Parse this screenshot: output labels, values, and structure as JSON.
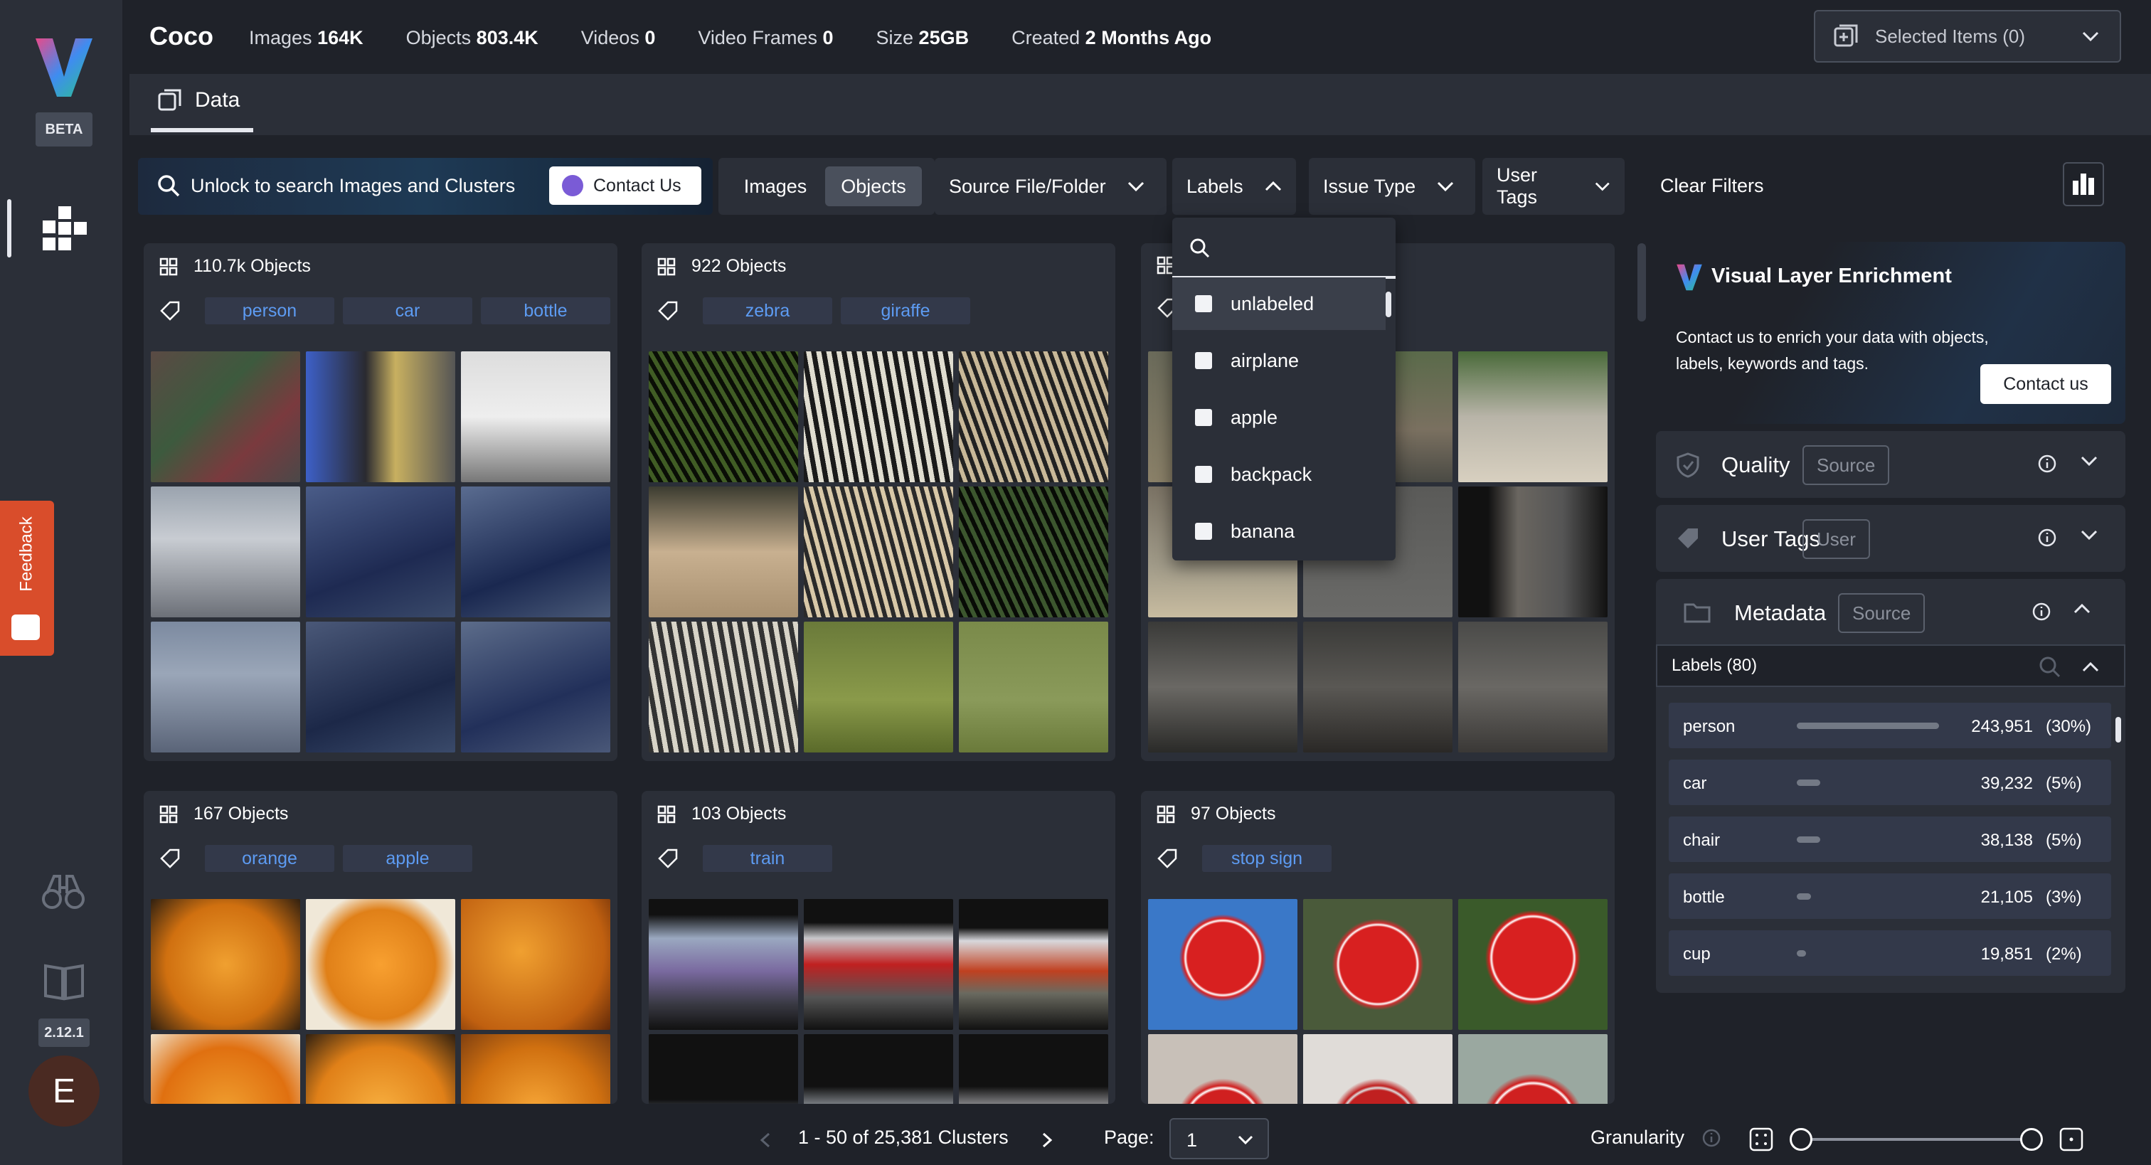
{
  "app": {
    "logo": "V",
    "badge": "BETA",
    "version": "2.12.1",
    "avatar_initial": "E",
    "feedback_label": "Feedback"
  },
  "header": {
    "dataset": "Coco",
    "stats": [
      {
        "label": "Images",
        "value": "164K"
      },
      {
        "label": "Objects",
        "value": "803.4K"
      },
      {
        "label": "Videos",
        "value": "0"
      },
      {
        "label": "Video Frames",
        "value": "0"
      },
      {
        "label": "Size",
        "value": "25GB"
      },
      {
        "label": "Created",
        "value": "2 Months Ago"
      }
    ],
    "selected_items": "Selected Items (0)"
  },
  "tabs": {
    "data": "Data"
  },
  "filters": {
    "search_placeholder": "Unlock to search Images and Clusters",
    "contact_us": "Contact Us",
    "images": "Images",
    "objects": "Objects",
    "source": "Source File/Folder",
    "labels": "Labels",
    "issue_type": "Issue Type",
    "user_tags": "User Tags",
    "clear": "Clear Filters"
  },
  "labels_dropdown": {
    "items": [
      "unlabeled",
      "airplane",
      "apple",
      "backpack",
      "banana"
    ]
  },
  "cards": [
    {
      "count": "110.7k Objects",
      "tags": [
        "person",
        "car",
        "bottle"
      ]
    },
    {
      "count": "922 Objects",
      "tags": [
        "zebra",
        "giraffe"
      ]
    },
    {
      "count": "",
      "tags": []
    },
    {
      "count": "167 Objects",
      "tags": [
        "orange",
        "apple"
      ]
    },
    {
      "count": "103 Objects",
      "tags": [
        "train"
      ]
    },
    {
      "count": "97 Objects",
      "tags": [
        "stop sign"
      ]
    }
  ],
  "enrichment": {
    "title": "Visual Layer Enrichment",
    "description": "Contact us to enrich your data with objects, labels, keywords and tags.",
    "button": "Contact us"
  },
  "panels": {
    "quality": {
      "label": "Quality",
      "badge": "Source"
    },
    "user_tags": {
      "label": "User Tags",
      "badge": "User"
    },
    "metadata": {
      "label": "Metadata",
      "badge": "Source"
    }
  },
  "label_stats": {
    "header": "Labels (80)",
    "rows": [
      {
        "name": "person",
        "count": "243,951",
        "pct": "(30%)",
        "share": 0.3
      },
      {
        "name": "car",
        "count": "39,232",
        "pct": "(5%)",
        "share": 0.05
      },
      {
        "name": "chair",
        "count": "38,138",
        "pct": "(5%)",
        "share": 0.05
      },
      {
        "name": "bottle",
        "count": "21,105",
        "pct": "(3%)",
        "share": 0.03
      },
      {
        "name": "cup",
        "count": "19,851",
        "pct": "(2%)",
        "share": 0.02
      }
    ]
  },
  "footer": {
    "range": "1 - 50 of 25,381 Clusters",
    "page_label": "Page:",
    "page_value": "1",
    "granularity": "Granularity"
  }
}
